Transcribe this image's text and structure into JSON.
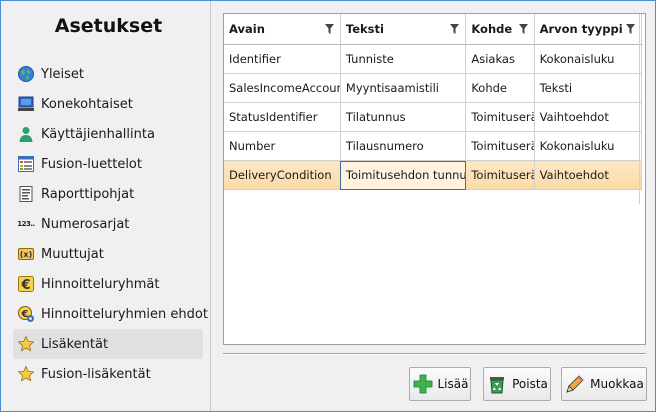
{
  "sidebar": {
    "title": "Asetukset",
    "items": [
      {
        "label": "Yleiset",
        "icon": "globe-icon"
      },
      {
        "label": "Konekohtaiset",
        "icon": "computer-icon"
      },
      {
        "label": "Käyttäjienhallinta",
        "icon": "user-icon"
      },
      {
        "label": "Fusion-luettelot",
        "icon": "list-icon"
      },
      {
        "label": "Raporttipohjat",
        "icon": "report-icon"
      },
      {
        "label": "Numerosarjat",
        "icon": "number-series-icon",
        "glyph": "123.."
      },
      {
        "label": "Muuttujat",
        "icon": "variable-icon"
      },
      {
        "label": "Hinnoitteluryhmät",
        "icon": "euro-icon"
      },
      {
        "label": "Hinnoitteluryhmien ehdot",
        "icon": "euro-gear-icon"
      },
      {
        "label": "Lisäkentät",
        "icon": "star-icon",
        "selected": true
      },
      {
        "label": "Fusion-lisäkentät",
        "icon": "star-icon"
      }
    ]
  },
  "grid": {
    "columns": [
      "Avain",
      "Teksti",
      "Kohde",
      "Arvon tyyppi"
    ],
    "rows": [
      [
        "Identifier",
        "Tunniste",
        "Asiakas",
        "Kokonaisluku"
      ],
      [
        "SalesIncomeAccount",
        "Myyntisaamistili",
        "Kohde",
        "Teksti"
      ],
      [
        "StatusIdentifier",
        "Tilatunnus",
        "Toimituserä",
        "Vaihtoehdot"
      ],
      [
        "Number",
        "Tilausnumero",
        "Toimituserä",
        "Kokonaisluku"
      ],
      [
        "DeliveryCondition",
        "Toimitusehdon tunnus",
        "Toimituserä",
        "Vaihtoehdot"
      ]
    ],
    "selected_row": 4
  },
  "buttons": {
    "add": "Lisää",
    "delete": "Poista",
    "edit": "Muokkaa"
  },
  "colors": {
    "selection": "#fbd9a6",
    "window_border": "#4a90d9"
  }
}
